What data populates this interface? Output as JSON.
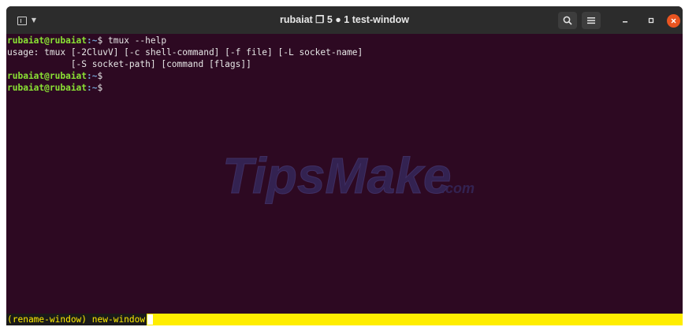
{
  "window": {
    "title": "rubaiat ❐ 5 ● 1 test-window"
  },
  "titlebar_icons": {
    "new_tab": "new-tab-icon",
    "dropdown": "chevron-down-icon",
    "search": "search-icon",
    "menu": "hamburger-menu-icon",
    "minimize": "minimize-icon",
    "maximize": "maximize-icon",
    "close": "close-icon"
  },
  "terminal": {
    "prompt_user": "rubaiat@rubaiat",
    "prompt_path": ":~",
    "prompt_sign": "$",
    "lines": [
      {
        "command": " tmux --help"
      },
      {
        "output": "usage: tmux [-2CluvV] [-c shell-command] [-f file] [-L socket-name]"
      },
      {
        "output": "            [-S socket-path] [command [flags]]"
      },
      {
        "command": ""
      },
      {
        "command": ""
      }
    ]
  },
  "watermark": {
    "brand": "TipsMake",
    "suffix": ".com"
  },
  "statusbar": {
    "prompt": "(rename-window) new-window"
  },
  "colors": {
    "terminal_bg": "#2d0922",
    "titlebar_bg": "#2c2c2c",
    "prompt_user": "#8ae234",
    "prompt_path": "#729fcf",
    "statusbar_bg": "#ffed00",
    "close_button": "#e95420"
  }
}
